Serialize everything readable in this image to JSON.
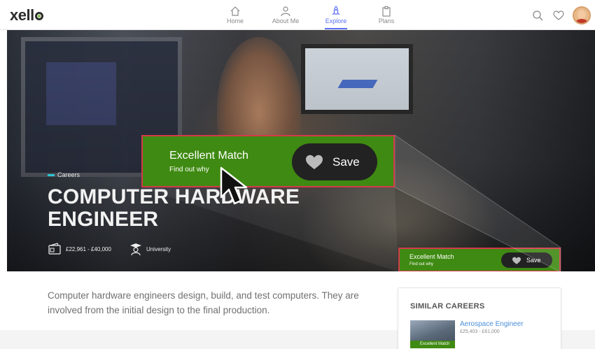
{
  "brand": {
    "logo_prefix": "xell"
  },
  "nav": [
    {
      "label": "Home",
      "icon": "home-icon"
    },
    {
      "label": "About Me",
      "icon": "person-icon"
    },
    {
      "label": "Explore",
      "icon": "rocket-icon",
      "active": true
    },
    {
      "label": "Plans",
      "icon": "clipboard-icon"
    }
  ],
  "header_icons": [
    "search-icon",
    "heart-icon",
    "avatar"
  ],
  "hero": {
    "breadcrumb": "Careers",
    "title": "COMPUTER HARDWARE ENGINEER",
    "salary": "£22,961 - £40,000",
    "education": "University"
  },
  "match": {
    "title": "Excellent Match",
    "link": "Find out why",
    "save_label": "Save"
  },
  "description": "Computer hardware engineers design, build, and test computers. They are involved from the initial design to the final production.",
  "similar": {
    "heading": "SIMILAR CAREERS",
    "items": [
      {
        "name": "Aerospace Engineer",
        "salary": "£25,403 - £61,000",
        "match": "Excellent Match"
      }
    ]
  },
  "colors": {
    "accent": "#5b6ef2",
    "match_green": "#3f8a12",
    "highlight_red": "#d33a4a"
  }
}
